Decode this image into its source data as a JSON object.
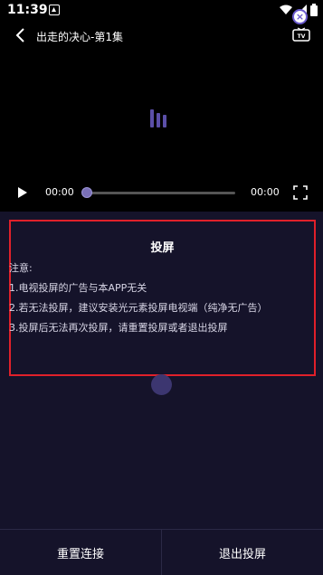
{
  "status_bar": {
    "time": "11:39"
  },
  "player": {
    "title": "出走的决心-第1集",
    "current_time": "00:00",
    "total_time": "00:00",
    "progress_percent": 0
  },
  "dialog": {
    "title": "投屏",
    "close_label": "×",
    "lines": [
      "注意:",
      "1.电视投屏的广告与本APP无关",
      "2.若无法投屏，建议安装光元素投屏电视端（纯净无广告）",
      "3.投屏后无法再次投屏，请重置投屏或者退出投屏"
    ]
  },
  "bottom_bar": {
    "reset_label": "重置连接",
    "exit_label": "退出投屏"
  },
  "colors": {
    "accent": "#6a5acd",
    "panel_bg": "#15132a",
    "highlight_border": "#e0202a"
  }
}
